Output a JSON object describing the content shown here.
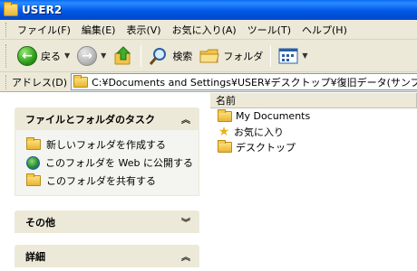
{
  "window": {
    "title": "USER2"
  },
  "menu": [
    "ファイル(F)",
    "編集(E)",
    "表示(V)",
    "お気に入り(A)",
    "ツール(T)",
    "ヘルプ(H)"
  ],
  "toolbar": {
    "back_label": "戻る",
    "search_label": "検索",
    "folders_label": "フォルダ"
  },
  "address": {
    "label": "アドレス(D)",
    "value": "C:¥Documents and Settings¥USER¥デスクトップ¥復旧データ(サンプル)¥Doc"
  },
  "taskpane": {
    "tasks_header": "ファイルとフォルダのタスク",
    "tasks": [
      {
        "icon": "new-folder-icon",
        "label": "新しいフォルダを作成する"
      },
      {
        "icon": "publish-web-icon",
        "label": "このフォルダを Web に公開する"
      },
      {
        "icon": "share-folder-icon",
        "label": "このフォルダを共有する"
      }
    ],
    "other_header": "その他",
    "details_header": "詳細"
  },
  "filelist": {
    "column_name": "名前",
    "items": [
      {
        "icon": "folder-icon",
        "name": "My Documents"
      },
      {
        "icon": "star-icon",
        "name": "お気に入り"
      },
      {
        "icon": "folder-icon",
        "name": "デスクトップ"
      }
    ]
  }
}
